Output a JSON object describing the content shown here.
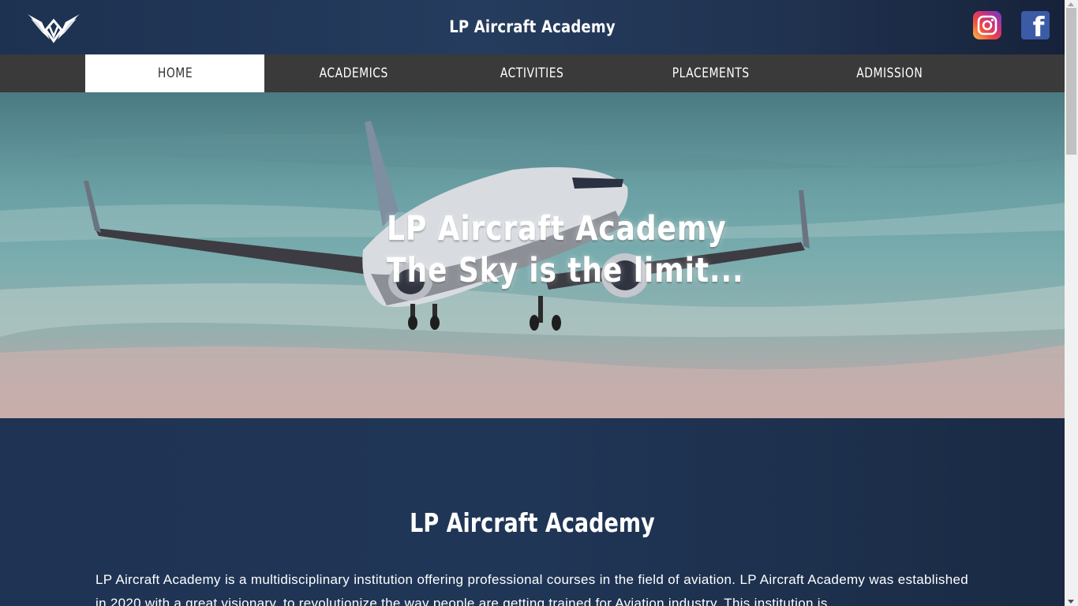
{
  "header": {
    "title": "LP Aircraft Academy",
    "logo_icon": "winged-emblem-icon",
    "social": [
      {
        "name": "instagram",
        "icon": "instagram-icon"
      },
      {
        "name": "facebook",
        "icon": "facebook-icon",
        "glyph": "f"
      }
    ]
  },
  "nav": {
    "items": [
      {
        "label": "HOME",
        "active": true
      },
      {
        "label": "ACADEMICS",
        "active": false
      },
      {
        "label": "ACTIVITIES",
        "active": false
      },
      {
        "label": "PLACEMENTS",
        "active": false
      },
      {
        "label": "ADMISSION",
        "active": false
      }
    ]
  },
  "hero": {
    "line1": "LP Aircraft Academy",
    "line2": "The Sky is the limit..."
  },
  "about": {
    "title": "LP Aircraft Academy",
    "text": "LP Aircraft Academy is a multidisciplinary institution offering professional courses in the field of aviation. LP Aircraft Academy was established in 2020 with a great visionary, to revolutionize the way people are getting trained for Aviation industry. This institution is"
  },
  "colors": {
    "header_bg": "#1d3150",
    "nav_bg": "#3a3a3a",
    "nav_active_bg": "#ffffff",
    "about_bg": "#1f3454"
  }
}
